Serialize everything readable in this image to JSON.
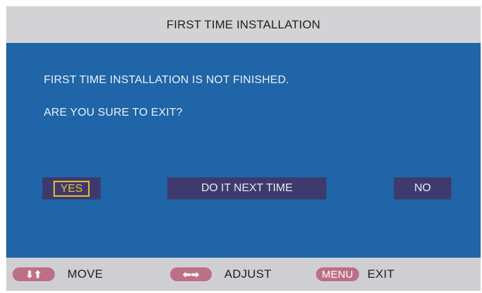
{
  "header": {
    "title": "FIRST TIME INSTALLATION"
  },
  "dialog": {
    "message_line1": "FIRST TIME INSTALLATION IS NOT FINISHED.",
    "message_line2": "ARE YOU SURE TO EXIT?",
    "buttons": {
      "yes": "YES",
      "next_time": "DO IT NEXT TIME",
      "no": "NO"
    },
    "selected_button": "yes"
  },
  "footer": {
    "move": {
      "icon": "up-down-arrows-icon",
      "key_glyph": "⬇⬆",
      "label": "MOVE"
    },
    "adjust": {
      "icon": "left-right-arrows-icon",
      "key_glyph": "⬅➡",
      "label": "ADJUST"
    },
    "exit": {
      "key_label": "MENU",
      "label": "EXIT"
    }
  },
  "colors": {
    "dialog_bg": "#1f65a8",
    "button_bg": "#3f3a6e",
    "selected_outline": "#e8c22b",
    "key_badge": "#bd6f86",
    "bar_bg": "#d3d3d5"
  }
}
